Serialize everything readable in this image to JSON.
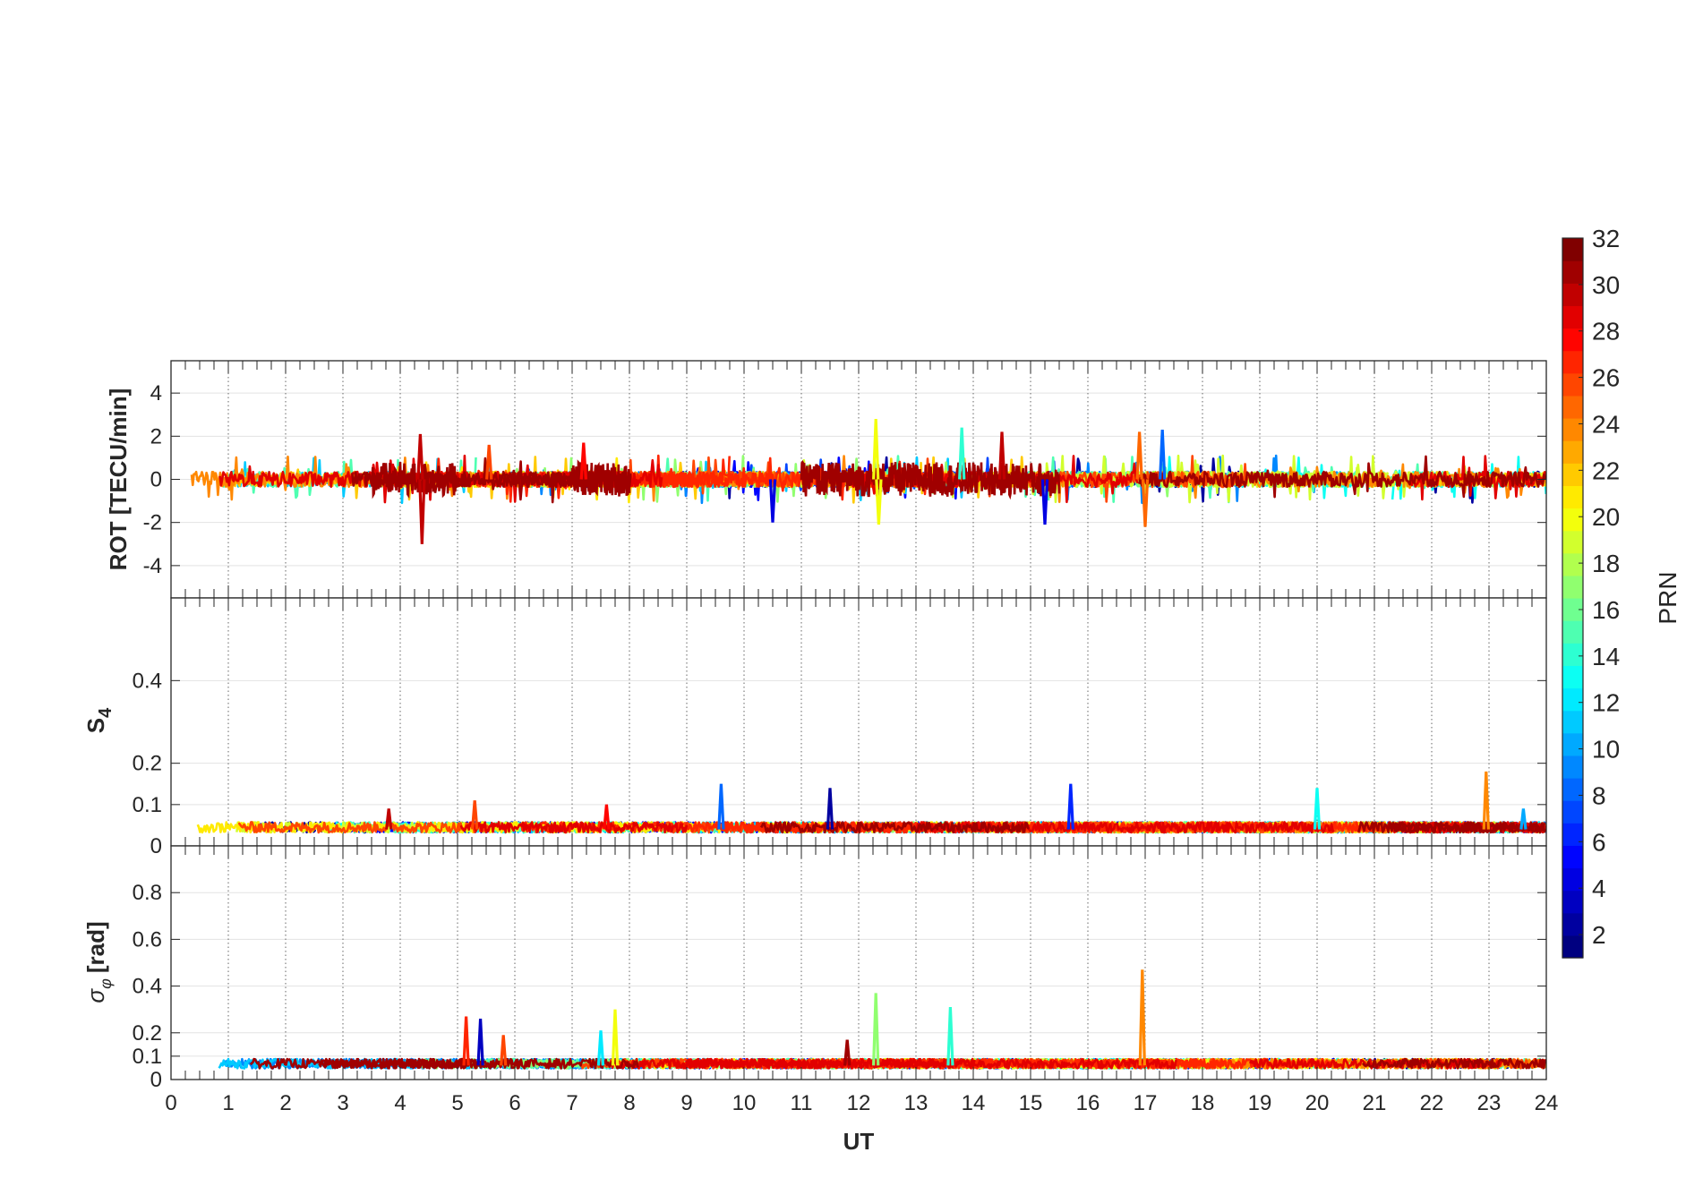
{
  "figure": {
    "colormap": "jet",
    "line_colors_by_prn": true
  },
  "chart_data": [
    {
      "panel": "rot",
      "type": "line",
      "ylabel": "ROT [TECU/min]",
      "ylim": [
        -5.5,
        5.5
      ],
      "yticks": [
        -4,
        -2,
        0,
        2,
        4
      ],
      "xlim": [
        0,
        24
      ],
      "grid": true,
      "series_note_values": "PRN-colored ROT traces around 0 with spikes",
      "spikes": [
        {
          "x": 4.35,
          "y": 2.1,
          "prn": 30
        },
        {
          "x": 4.38,
          "y": -3.0,
          "prn": 30
        },
        {
          "x": 5.55,
          "y": 1.6,
          "prn": 26
        },
        {
          "x": 7.2,
          "y": 1.7,
          "prn": 28
        },
        {
          "x": 10.5,
          "y": -2.0,
          "prn": 4
        },
        {
          "x": 12.3,
          "y": 2.8,
          "prn": 20
        },
        {
          "x": 12.35,
          "y": -2.1,
          "prn": 20
        },
        {
          "x": 13.8,
          "y": 2.4,
          "prn": 14
        },
        {
          "x": 14.5,
          "y": 2.2,
          "prn": 30
        },
        {
          "x": 15.25,
          "y": -2.1,
          "prn": 4
        },
        {
          "x": 16.9,
          "y": 2.2,
          "prn": 25
        },
        {
          "x": 17.0,
          "y": -2.2,
          "prn": 25
        },
        {
          "x": 17.3,
          "y": 2.3,
          "prn": 8
        }
      ]
    },
    {
      "panel": "s4",
      "type": "line",
      "ylabel_main": "S",
      "ylabel_sub": "4",
      "ylim": [
        0,
        0.6
      ],
      "yticks": [
        0,
        0.1,
        0.2,
        0.4
      ],
      "ytick_labels": [
        "0",
        "0.1",
        "0.2",
        "0.4"
      ],
      "xlim": [
        0,
        24
      ],
      "grid": true,
      "baseline": 0.04,
      "spikes": [
        {
          "x": 3.8,
          "y": 0.09,
          "prn": 30
        },
        {
          "x": 5.3,
          "y": 0.11,
          "prn": 26
        },
        {
          "x": 7.6,
          "y": 0.1,
          "prn": 28
        },
        {
          "x": 9.6,
          "y": 0.15,
          "prn": 8
        },
        {
          "x": 11.5,
          "y": 0.14,
          "prn": 2
        },
        {
          "x": 15.7,
          "y": 0.15,
          "prn": 6
        },
        {
          "x": 20.0,
          "y": 0.14,
          "prn": 13
        },
        {
          "x": 22.95,
          "y": 0.18,
          "prn": 24
        },
        {
          "x": 23.6,
          "y": 0.09,
          "prn": 10
        }
      ]
    },
    {
      "panel": "sigma_phi",
      "type": "line",
      "ylabel_symbol": "σ",
      "ylabel_sub": "φ",
      "ylabel_unit": "[rad]",
      "ylim": [
        0,
        1.0
      ],
      "yticks": [
        0,
        0.1,
        0.2,
        0.4,
        0.6,
        0.8
      ],
      "ytick_labels": [
        "0",
        "0.1",
        "0.2",
        "0.4",
        "0.6",
        "0.8"
      ],
      "xlim": [
        0,
        24
      ],
      "xticks": [
        0,
        1,
        2,
        3,
        4,
        5,
        6,
        7,
        8,
        9,
        10,
        11,
        12,
        13,
        14,
        15,
        16,
        17,
        18,
        19,
        20,
        21,
        22,
        23,
        24
      ],
      "xlabel": "UT",
      "grid": true,
      "baseline": 0.06,
      "spikes": [
        {
          "x": 5.15,
          "y": 0.27,
          "prn": 27
        },
        {
          "x": 5.4,
          "y": 0.26,
          "prn": 3
        },
        {
          "x": 5.8,
          "y": 0.19,
          "prn": 26
        },
        {
          "x": 7.75,
          "y": 0.3,
          "prn": 20
        },
        {
          "x": 7.5,
          "y": 0.21,
          "prn": 12
        },
        {
          "x": 12.3,
          "y": 0.37,
          "prn": 17
        },
        {
          "x": 13.6,
          "y": 0.31,
          "prn": 14
        },
        {
          "x": 16.95,
          "y": 0.47,
          "prn": 24
        },
        {
          "x": 11.8,
          "y": 0.17,
          "prn": 31
        }
      ]
    }
  ],
  "colorbar": {
    "label": "PRN",
    "range": [
      1,
      32
    ],
    "ticks": [
      2,
      4,
      6,
      8,
      10,
      12,
      14,
      16,
      18,
      20,
      22,
      24,
      26,
      28,
      30,
      32
    ],
    "tick_labels": [
      "2",
      "4",
      "6",
      "8",
      "10",
      "12",
      "14",
      "16",
      "18",
      "20",
      "22",
      "24",
      "26",
      "28",
      "30",
      "32"
    ]
  }
}
